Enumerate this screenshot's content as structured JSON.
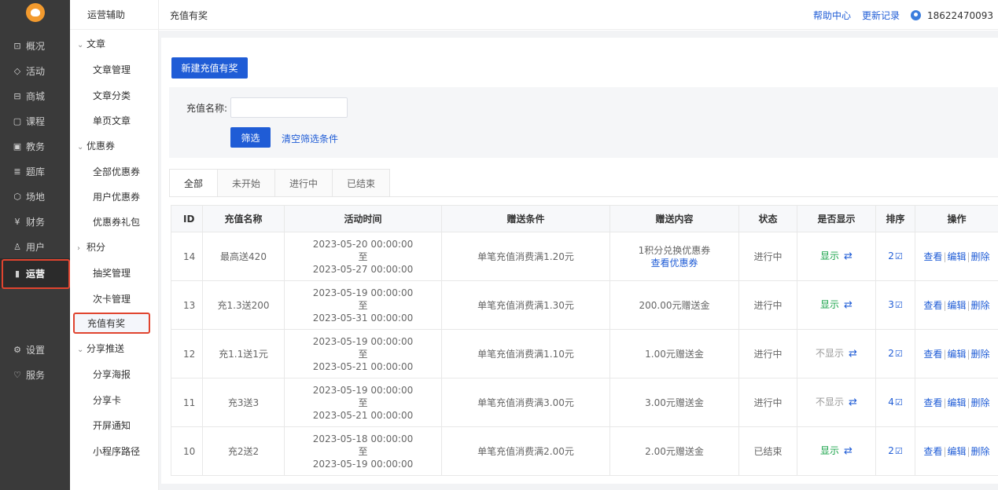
{
  "leftnav": {
    "items": [
      {
        "label": "概况",
        "icon": "chat-icon",
        "glyph": "⊡"
      },
      {
        "label": "活动",
        "icon": "tag-icon",
        "glyph": "◇"
      },
      {
        "label": "商城",
        "icon": "shop-icon",
        "glyph": "⊟"
      },
      {
        "label": "课程",
        "icon": "course-icon",
        "glyph": "▢"
      },
      {
        "label": "教务",
        "icon": "calendar-icon",
        "glyph": "▣"
      },
      {
        "label": "题库",
        "icon": "list-icon",
        "glyph": "≣"
      },
      {
        "label": "场地",
        "icon": "cube-icon",
        "glyph": "⬡"
      },
      {
        "label": "财务",
        "icon": "yen-icon",
        "glyph": "¥"
      },
      {
        "label": "用户",
        "icon": "user-icon",
        "glyph": "♙"
      },
      {
        "label": "运营",
        "icon": "bar-chart-icon",
        "glyph": "▮"
      },
      {
        "label": "设置",
        "icon": "gear-icon",
        "glyph": "⚙"
      },
      {
        "label": "服务",
        "icon": "heart-icon",
        "glyph": "♡"
      }
    ]
  },
  "subnav": {
    "title": "运营辅助",
    "rows": [
      {
        "label": "文章",
        "kind": "group",
        "caret": "⌄"
      },
      {
        "label": "文章管理",
        "kind": "leaf"
      },
      {
        "label": "文章分类",
        "kind": "leaf"
      },
      {
        "label": "单页文章",
        "kind": "leaf"
      },
      {
        "label": "优惠券",
        "kind": "group",
        "caret": "⌄"
      },
      {
        "label": "全部优惠券",
        "kind": "leaf"
      },
      {
        "label": "用户优惠券",
        "kind": "leaf"
      },
      {
        "label": "优惠券礼包",
        "kind": "leaf"
      },
      {
        "label": "积分",
        "kind": "group",
        "caret": "›"
      },
      {
        "label": "抽奖管理",
        "kind": "group-plain"
      },
      {
        "label": "次卡管理",
        "kind": "group-plain"
      },
      {
        "label": "充值有奖",
        "kind": "selected"
      },
      {
        "label": "分享推送",
        "kind": "group",
        "caret": "⌄"
      },
      {
        "label": "分享海报",
        "kind": "leaf"
      },
      {
        "label": "分享卡",
        "kind": "leaf"
      },
      {
        "label": "开屏通知",
        "kind": "leaf"
      },
      {
        "label": "小程序路径",
        "kind": "leaf"
      }
    ]
  },
  "topbar": {
    "breadcrumb": "充值有奖",
    "help": "帮助中心",
    "changelog": "更新记录",
    "user": "18622470093"
  },
  "main": {
    "new_button": "新建充值有奖",
    "filter": {
      "name_label": "充值名称:",
      "name_value": "",
      "name_placeholder": "",
      "filter_button": "筛选",
      "clear_link": "清空筛选条件"
    },
    "tabs": [
      "全部",
      "未开始",
      "进行中",
      "已结束"
    ],
    "table": {
      "headers": [
        "ID",
        "充值名称",
        "活动时间",
        "赠送条件",
        "赠送内容",
        "状态",
        "是否显示",
        "排序",
        "操作"
      ],
      "rows": [
        {
          "id": "14",
          "name": "最高送420",
          "start": "2023-05-20 00:00:00",
          "to": "至",
          "end": "2023-05-27 00:00:00",
          "condition": "单笔充值消费满1.20元",
          "content": "1积分兑换优惠券",
          "content_link": "查看优惠券",
          "status": "进行中",
          "display": "显示",
          "sort": "2"
        },
        {
          "id": "13",
          "name": "充1.3送200",
          "start": "2023-05-19 00:00:00",
          "to": "至",
          "end": "2023-05-31 00:00:00",
          "condition": "单笔充值消费满1.30元",
          "content": "200.00元赠送金",
          "content_link": "",
          "status": "进行中",
          "display": "显示",
          "sort": "3"
        },
        {
          "id": "12",
          "name": "充1.1送1元",
          "start": "2023-05-19 00:00:00",
          "to": "至",
          "end": "2023-05-21 00:00:00",
          "condition": "单笔充值消费满1.10元",
          "content": "1.00元赠送金",
          "content_link": "",
          "status": "进行中",
          "display": "不显示",
          "sort": "2"
        },
        {
          "id": "11",
          "name": "充3送3",
          "start": "2023-05-19 00:00:00",
          "to": "至",
          "end": "2023-05-21 00:00:00",
          "condition": "单笔充值消费满3.00元",
          "content": "3.00元赠送金",
          "content_link": "",
          "status": "进行中",
          "display": "不显示",
          "sort": "4"
        },
        {
          "id": "10",
          "name": "充2送2",
          "start": "2023-05-18 00:00:00",
          "to": "至",
          "end": "2023-05-19 00:00:00",
          "condition": "单笔充值消费满2.00元",
          "content": "2.00元赠送金",
          "content_link": "",
          "status": "已结束",
          "display": "显示",
          "sort": "2"
        }
      ],
      "ops": [
        "查看",
        "编辑",
        "删除"
      ]
    }
  },
  "colors": {
    "accent": "#1f5cd6",
    "highlight": "#e0442f",
    "active_green": "#1aa34a",
    "nav_bg": "#3a3a3a"
  }
}
